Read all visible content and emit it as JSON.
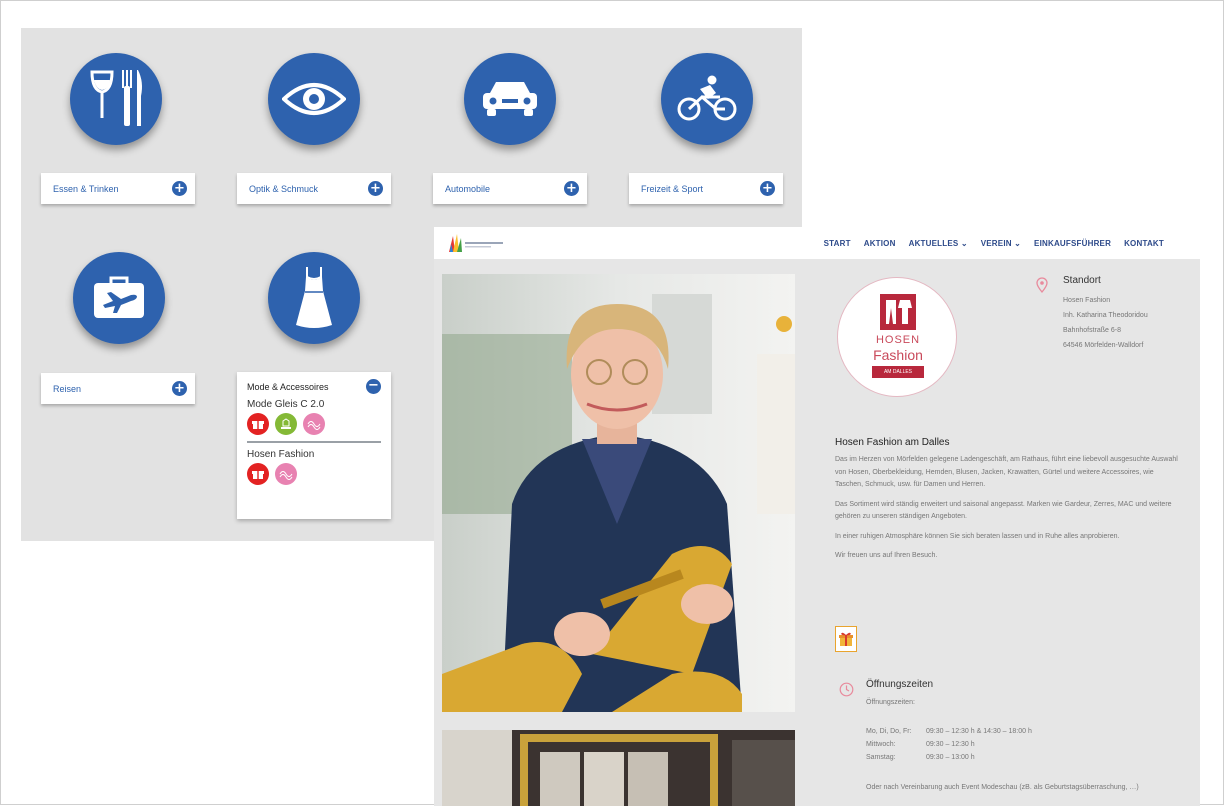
{
  "categories": [
    {
      "label": "Essen & Trinken",
      "icon": "cutlery-icon"
    },
    {
      "label": "Optik & Schmuck",
      "icon": "eye-icon"
    },
    {
      "label": "Automobile",
      "icon": "car-icon"
    },
    {
      "label": "Freizeit & Sport",
      "icon": "bicycle-icon"
    },
    {
      "label": "Reisen",
      "icon": "travel-suitcase-icon"
    }
  ],
  "expanded_category": {
    "label": "Mode & Accessoires",
    "icon": "dress-icon",
    "shops": [
      {
        "name": "Mode Gleis C 2.0"
      },
      {
        "name": "Hosen Fashion"
      }
    ]
  },
  "nav": {
    "items": [
      "START",
      "AKTION",
      "AKTUELLES ⌄",
      "VEREIN ⌄",
      "EINKAUFSFÜHRER",
      "KONTAKT"
    ]
  },
  "shop_logo": {
    "line1": "HOSEN",
    "line2": "Fashion",
    "band": "AM DALLES"
  },
  "location": {
    "title": "Standort",
    "lines": [
      "Hosen Fashion",
      "Inh. Katharina Theodoridou",
      "Bahnhofstraße 6-8",
      "64546 Mörfelden-Walldorf"
    ]
  },
  "description": {
    "title": "Hosen Fashion am Dalles",
    "paragraphs": [
      "Das im Herzen von Mörfelden gelegene Ladengeschäft, am Rathaus, führt eine liebevoll ausgesuchte Auswahl von Hosen, Oberbekleidung, Hemden, Blusen, Jacken, Krawatten, Gürtel und weitere Accessoires, wie Taschen, Schmuck, usw. für Damen und Herren.",
      "Das Sortiment wird ständig erweitert und saisonal angepasst. Marken wie Gardeur, Zerres, MAC und weitere gehören zu unseren ständigen Angeboten.",
      "In einer ruhigen Atmosphäre können Sie sich beraten lassen und in Ruhe alles anprobieren.",
      "Wir freuen uns auf Ihren Besuch."
    ]
  },
  "hours": {
    "title": "Öffnungszeiten",
    "subtitle": "Öffnungszeiten:",
    "rows": [
      {
        "day": "Mo, Di, Do, Fr:",
        "time": "09:30 – 12:30 h & 14:30 – 18:00 h"
      },
      {
        "day": "Mittwoch:",
        "time": "09:30 – 12:30 h"
      },
      {
        "day": "Samstag:",
        "time": "09:30 – 13:00 h"
      }
    ],
    "note": "Oder nach Vereinbarung auch Event Modeschau (zB. als Geburtstagsüberraschung, …)"
  },
  "colors": {
    "primary_blue": "#2e62ae",
    "nav_text": "#2d4a8a",
    "brand_red": "#b8283c"
  }
}
